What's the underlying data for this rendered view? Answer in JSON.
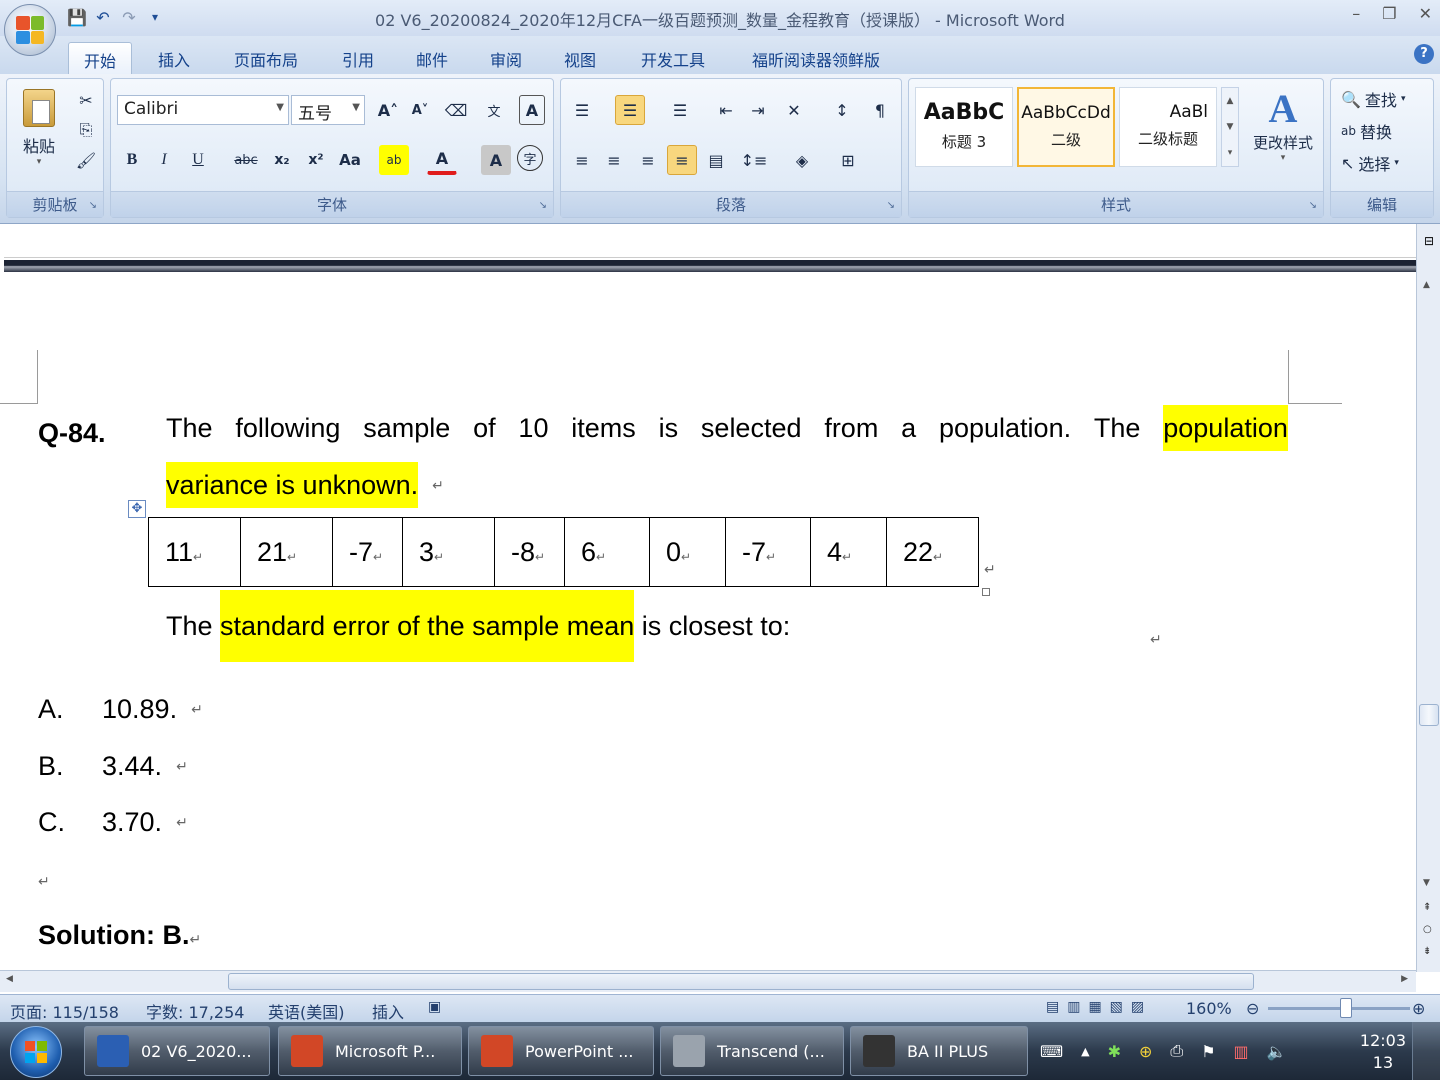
{
  "window": {
    "title": "02 V6_20200824_2020年12月CFA一级百题预测_数量_金程教育（授课版） - Microsoft Word",
    "controls": [
      "–",
      "❐",
      "✕"
    ]
  },
  "quick_access": {
    "save_icon": "💾",
    "undo_icon": "↶",
    "redo_icon": "↷",
    "customize_icon": "▾"
  },
  "tabs": [
    "开始",
    "插入",
    "页面布局",
    "引用",
    "邮件",
    "审阅",
    "视图",
    "开发工具",
    "福昕阅读器领鲜版"
  ],
  "active_tab": "开始",
  "ribbon": {
    "clipboard": {
      "label": "剪贴板",
      "paste": "粘贴"
    },
    "font": {
      "label": "字体",
      "family": "Calibri",
      "size": "五号"
    },
    "paragraph": {
      "label": "段落"
    },
    "styles": {
      "label": "样式",
      "items": [
        {
          "sample": "AaBbC",
          "name": "标题 3"
        },
        {
          "sample": "AaBbCcDd",
          "name": "二级"
        },
        {
          "sample": "AaBl",
          "name": "二级标题"
        }
      ],
      "change_styles": "更改样式"
    },
    "editing": {
      "label": "编辑",
      "find": "查找",
      "replace": "替换",
      "select": "选择"
    }
  },
  "document": {
    "question_label": "Q-84.",
    "line1_words": [
      "The",
      "following",
      "sample",
      "of",
      "10",
      "items",
      "is",
      "selected",
      "from",
      "a",
      "population.",
      "The"
    ],
    "line1_highlight": "population",
    "line2_highlight": "variance is unknown.",
    "sample_values": [
      "11",
      "21",
      "-7",
      "3",
      "-8",
      "6",
      "0",
      "-7",
      "4",
      "22"
    ],
    "line3_pre": "The ",
    "line3_highlight": "standard error of the sample mean",
    "line3_post": " is closest to:",
    "options": [
      {
        "letter": "A.",
        "text": "10.89."
      },
      {
        "letter": "B.",
        "text": "3.44."
      },
      {
        "letter": "C.",
        "text": "3.70."
      }
    ],
    "solution": "Solution: B.",
    "paragraph_mark": "↵",
    "highlight_color": "#ffff00"
  },
  "status_bar": {
    "page": "页面: 115/158",
    "words": "字数: 17,254",
    "language": "英语(美国)",
    "mode": "插入",
    "zoom": "160%"
  },
  "taskbar": {
    "items": [
      {
        "label": "02 V6_2020...",
        "icon_color": "#2b5fb3"
      },
      {
        "label": "Microsoft P...",
        "icon_color": "#d24726"
      },
      {
        "label": "PowerPoint ...",
        "icon_color": "#d24726"
      },
      {
        "label": "Transcend (...",
        "icon_color": "#9aa3ad"
      },
      {
        "label": "BA II PLUS",
        "icon_color": "#333333"
      }
    ],
    "time": "12:03",
    "date": "13"
  }
}
